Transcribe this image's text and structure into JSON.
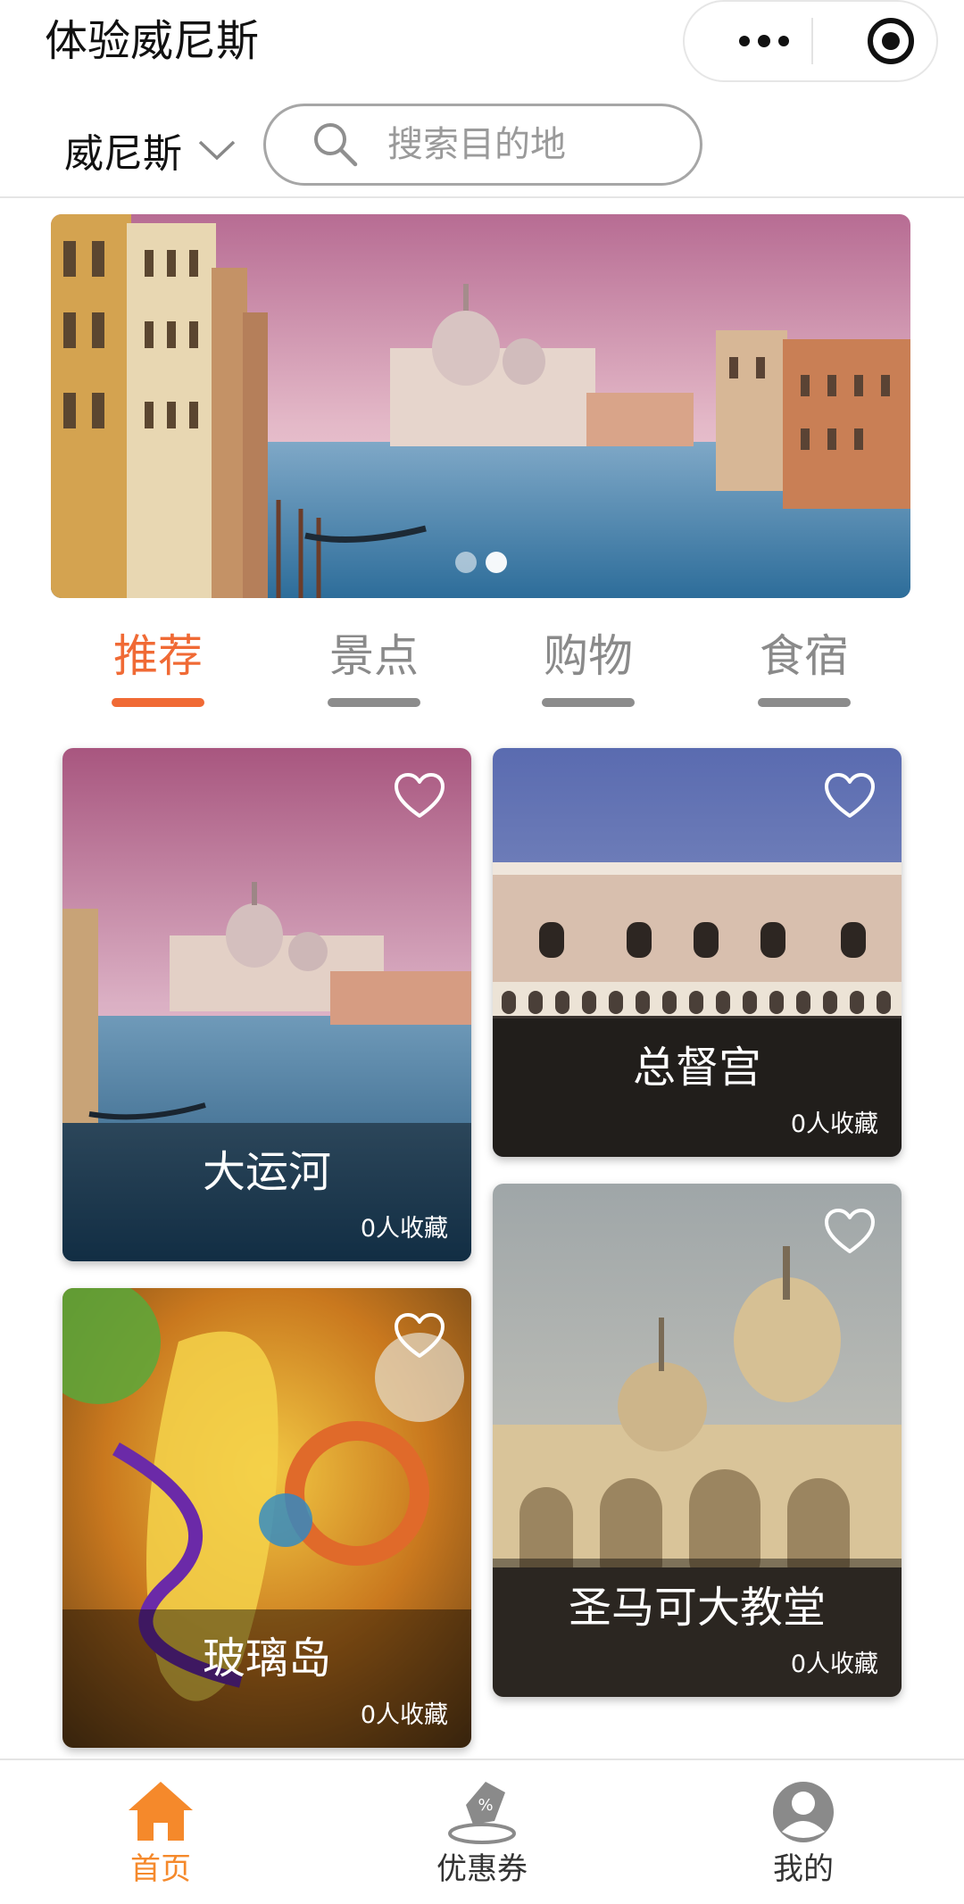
{
  "app": {
    "title": "体验威尼斯"
  },
  "search": {
    "city": "威尼斯",
    "placeholder": "搜索目的地"
  },
  "tabs": [
    {
      "label": "推荐",
      "active": true
    },
    {
      "label": "景点",
      "active": false
    },
    {
      "label": "购物",
      "active": false
    },
    {
      "label": "食宿",
      "active": false
    }
  ],
  "cards": [
    {
      "name": "大运河",
      "favorites": "0人收藏"
    },
    {
      "name": "总督宫",
      "favorites": "0人收藏"
    },
    {
      "name": "玻璃岛",
      "favorites": "0人收藏"
    },
    {
      "name": "圣马可大教堂",
      "favorites": "0人收藏"
    }
  ],
  "nav": [
    {
      "label": "首页",
      "icon": "home-icon",
      "active": true
    },
    {
      "label": "优惠券",
      "icon": "coupon-icon",
      "active": false
    },
    {
      "label": "我的",
      "icon": "profile-icon",
      "active": false
    }
  ],
  "colors": {
    "accent": "#f06a35",
    "nav_active": "#f5892b",
    "inactive": "#8a8a8a"
  }
}
